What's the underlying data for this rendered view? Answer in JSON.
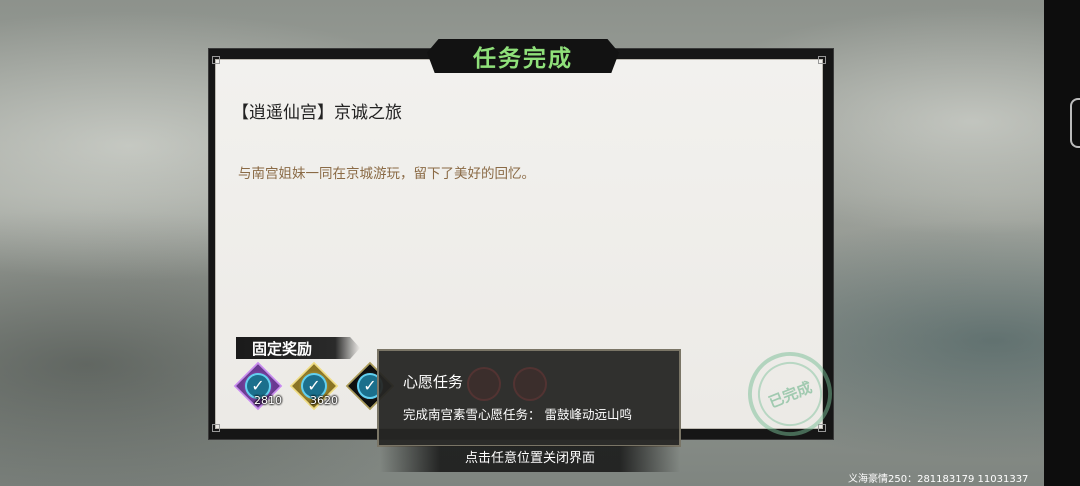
{
  "dialog": {
    "title": "任务完成",
    "quest_name": "【逍遥仙宫】京诚之旅",
    "description": "与南宫姐妹一同在京城游玩，留下了美好的回忆。",
    "rewards_label": "固定奖励",
    "rewards": [
      {
        "icon": "purple-gem-icon",
        "count": "2810",
        "color": "#8a4fb5"
      },
      {
        "icon": "gold-gem-icon",
        "count": "3620",
        "color": "#c9ae3c"
      },
      {
        "icon": "dark-token-icon",
        "count": "",
        "color": "#1a1a1a"
      }
    ],
    "stamp_text": "已完成"
  },
  "tooltip": {
    "title": "心愿任务",
    "body": "完成南宫素雪心愿任务：  雷鼓峰动远山鸣"
  },
  "close_hint": "点击任意位置关闭界面",
  "version_info": "义海豪情250：281183179  11031337",
  "colors": {
    "title_green": "#8fe07a",
    "desc_brown": "#8a6a45",
    "paper": "#efeeea",
    "check_blue": "#1b6f8c"
  }
}
